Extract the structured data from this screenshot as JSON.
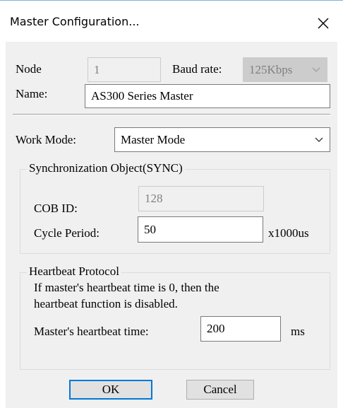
{
  "window": {
    "title": "Master Configuration..."
  },
  "node": {
    "label": "Node",
    "value": "1"
  },
  "baud_rate": {
    "label": "Baud rate:",
    "selected": "125Kbps"
  },
  "name": {
    "label": "Name:",
    "value": "AS300 Series Master"
  },
  "work_mode": {
    "label": "Work Mode:",
    "selected": "Master Mode"
  },
  "sync": {
    "group_title": "Synchronization Object(SYNC)",
    "cob_id_label": "COB ID:",
    "cob_id_value": "128",
    "cycle_period_label": "Cycle Period:",
    "cycle_period_value": "50",
    "cycle_period_unit": "x1000us"
  },
  "heartbeat": {
    "group_title": "Heartbeat Protocol",
    "note_line1": "If master's heartbeat time is 0, then the",
    "note_line2": "heartbeat function is disabled.",
    "time_label": "Master's heartbeat time:",
    "time_value": "200",
    "time_unit": "ms"
  },
  "buttons": {
    "ok": "OK",
    "cancel": "Cancel"
  },
  "icons": {
    "close": "close-icon",
    "dropdown": "chevron-down-icon"
  }
}
